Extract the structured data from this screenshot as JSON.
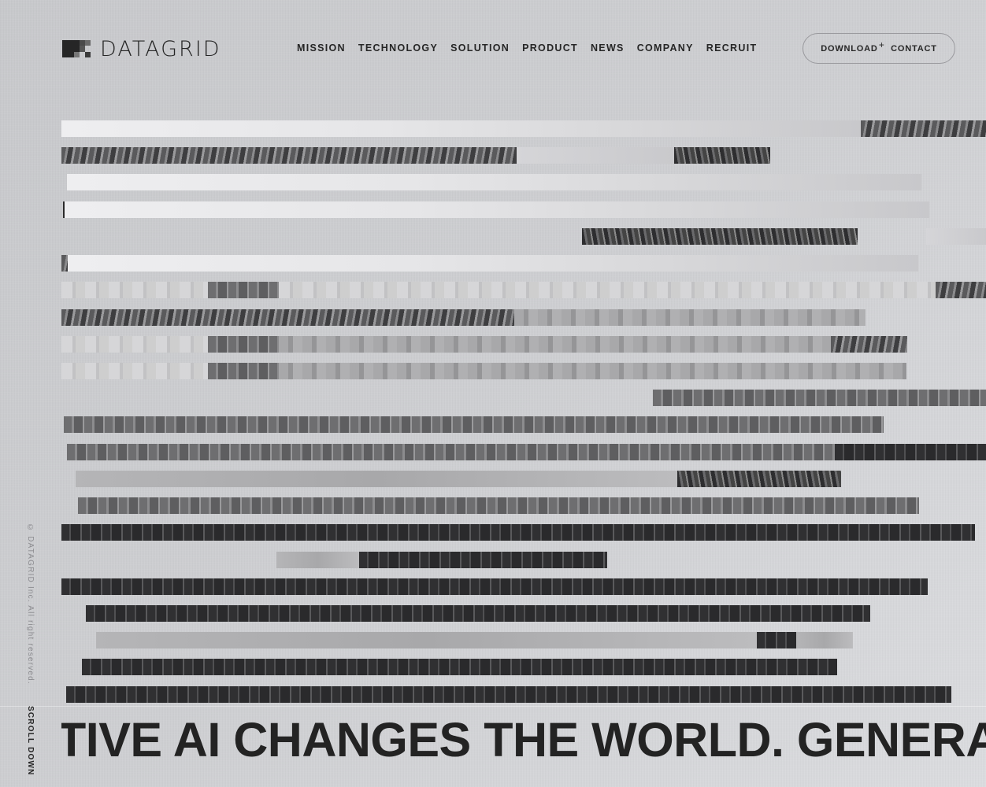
{
  "brand": {
    "name": "DATAGRID",
    "logo_icon": "pixel-grid-logo"
  },
  "nav": {
    "items": [
      {
        "label": "MISSION"
      },
      {
        "label": "TECHNOLOGY"
      },
      {
        "label": "SOLUTION"
      },
      {
        "label": "PRODUCT"
      },
      {
        "label": "NEWS"
      },
      {
        "label": "COMPANY"
      },
      {
        "label": "RECRUIT"
      }
    ]
  },
  "cta": {
    "download_label": "DOWNLOAD",
    "download_icon": "+",
    "contact_label": "CONTACT"
  },
  "hero": {
    "image_description": "glitched horizontal strips of grayscale cityscape and marbled textures",
    "marquee_text": "TIVE AI CHANGES THE WORLD. GENERATIVE AI CHANGES THE WORLD. GENERA"
  },
  "side": {
    "copyright": "© DATAGRID Inc. All right reserved.",
    "scroll_label": "SCROLL DOWN"
  },
  "colors": {
    "background": "#cfd0d3",
    "text": "#262626",
    "muted": "#8c8c90"
  }
}
